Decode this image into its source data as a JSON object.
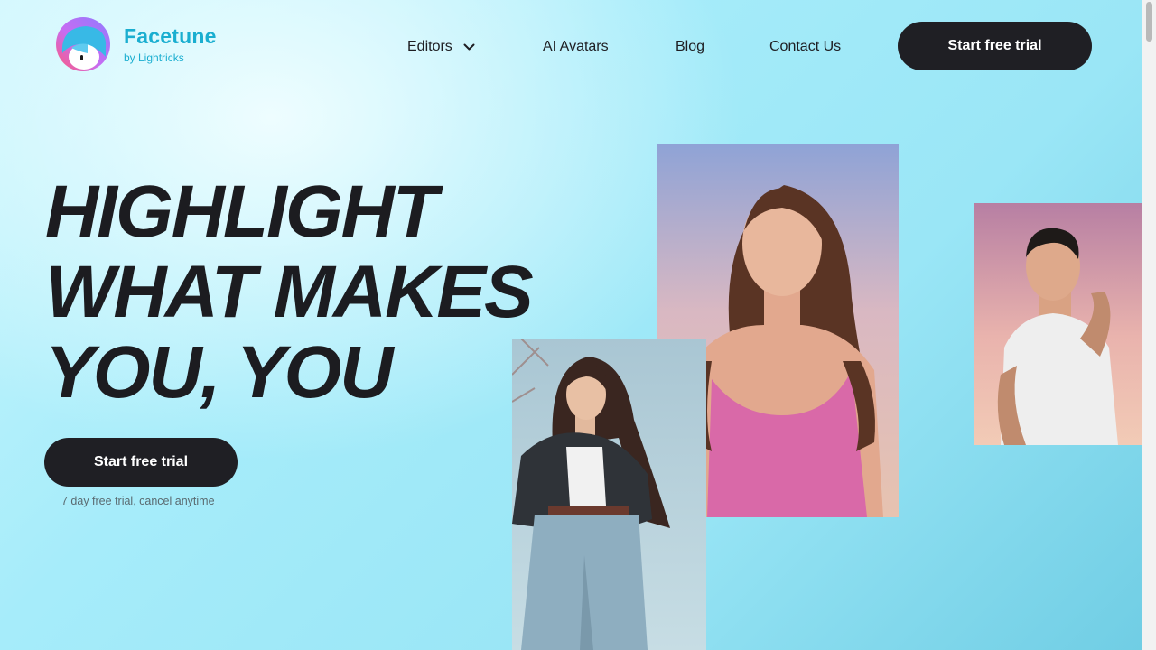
{
  "header": {
    "brand": "Facetune",
    "brand_sub": "by Lightricks",
    "nav": [
      {
        "label": "Editors",
        "icon": "chevron-down-icon"
      },
      {
        "label": "AI Avatars"
      },
      {
        "label": "Blog"
      },
      {
        "label": "Contact Us"
      }
    ],
    "cta_label": "Start free trial"
  },
  "hero": {
    "title_lines": [
      "HIGHLIGHT",
      "WHAT MAKES",
      "YOU, YOU"
    ],
    "cta_label": "Start free trial",
    "note": "7 day free trial, cancel anytime"
  },
  "colors": {
    "brand": "#1aaed0",
    "button": "#1f1f24",
    "text": "#1c1c20"
  }
}
